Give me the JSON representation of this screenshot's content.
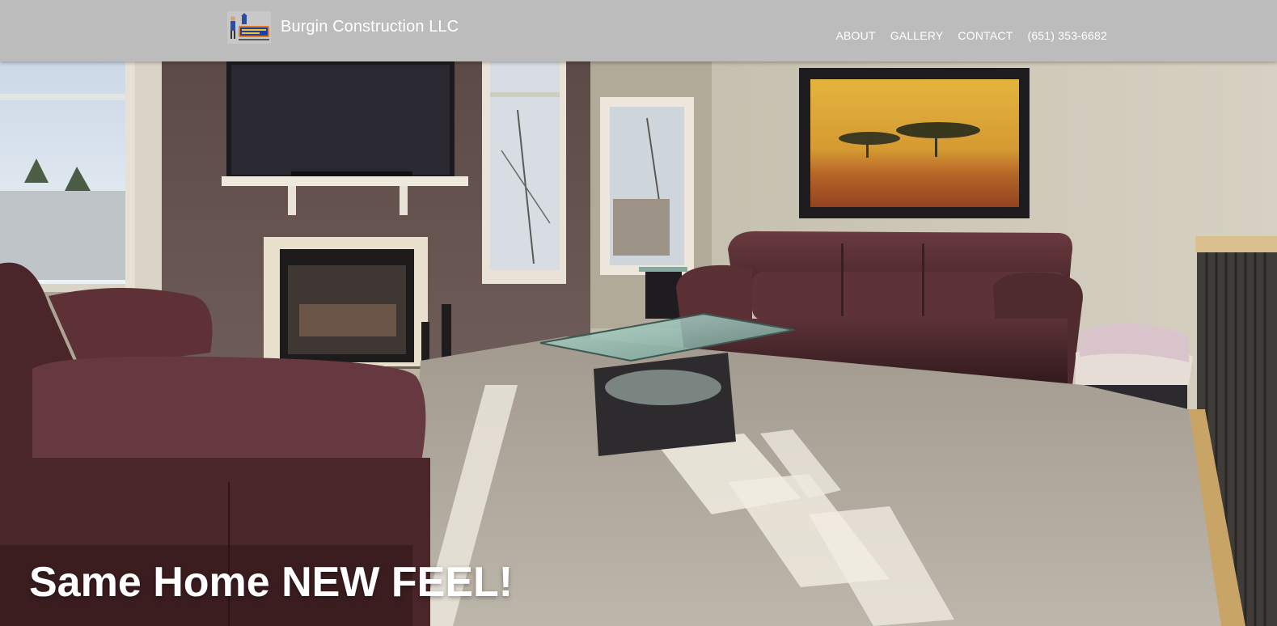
{
  "header": {
    "brand_name": "Burgin Construction LLC",
    "logo_icon": "company-logo-icon",
    "background_color": "#bcbcbc"
  },
  "nav": {
    "items": [
      {
        "label": "ABOUT"
      },
      {
        "label": "GALLERY"
      },
      {
        "label": "CONTACT"
      },
      {
        "label": "(651) 353-6682"
      }
    ]
  },
  "hero": {
    "title": "Same Home NEW FEEL!",
    "image": "living-room-photo"
  }
}
